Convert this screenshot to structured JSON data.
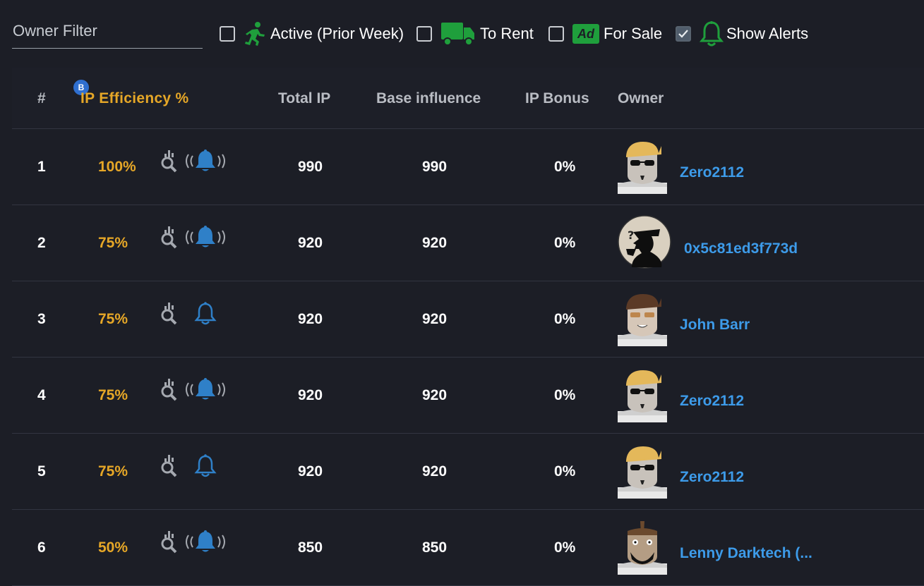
{
  "filters": {
    "owner_placeholder": "Owner Filter",
    "active_label": "Active (Prior Week)",
    "rent_label": "To Rent",
    "sale_label": "For Sale",
    "sale_icon_text": "Ad",
    "alerts_label": "Show Alerts",
    "active_checked": false,
    "rent_checked": false,
    "sale_checked": false,
    "alerts_checked": true,
    "accent_green": "#1f9f3c"
  },
  "badge": "B",
  "headers": {
    "num": "#",
    "efficiency": "IP Efficiency %",
    "total": "Total IP",
    "base": "Base influence",
    "bonus": "IP Bonus",
    "owner": "Owner"
  },
  "colors": {
    "gold": "#e6a727",
    "link": "#3d9be9",
    "bell": "#2f80c8",
    "background": "#1c1e26"
  },
  "rows": [
    {
      "num": "1",
      "eff": "100%",
      "total": "990",
      "base": "990",
      "bonus": "0%",
      "owner": "Zero2112",
      "avatar": "blonde-sunglasses-avatar",
      "alert": "ringing-bell-icon"
    },
    {
      "num": "2",
      "eff": "75%",
      "total": "920",
      "base": "920",
      "bonus": "0%",
      "owner": "0x5c81ed3f773d",
      "avatar": "detective-silhouette-avatar",
      "alert": "ringing-bell-icon"
    },
    {
      "num": "3",
      "eff": "75%",
      "total": "920",
      "base": "920",
      "bonus": "0%",
      "owner": "John Barr",
      "avatar": "brown-hair-glasses-avatar",
      "alert": "bell-outline-icon"
    },
    {
      "num": "4",
      "eff": "75%",
      "total": "920",
      "base": "920",
      "bonus": "0%",
      "owner": "Zero2112",
      "avatar": "blonde-sunglasses-avatar",
      "alert": "ringing-bell-icon"
    },
    {
      "num": "5",
      "eff": "75%",
      "total": "920",
      "base": "920",
      "bonus": "0%",
      "owner": "Zero2112",
      "avatar": "blonde-sunglasses-avatar",
      "alert": "bell-outline-icon"
    },
    {
      "num": "6",
      "eff": "50%",
      "total": "850",
      "base": "850",
      "bonus": "0%",
      "owner": "Lenny Darktech (...",
      "avatar": "mohawk-beard-avatar",
      "alert": "ringing-bell-icon"
    }
  ]
}
